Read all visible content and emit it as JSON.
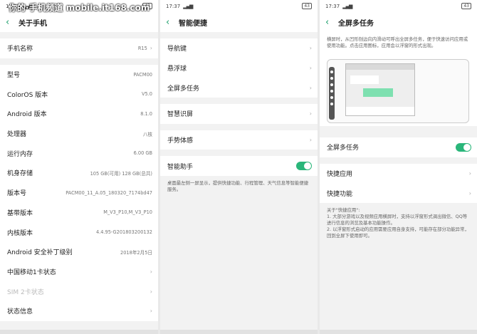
{
  "watermark": "你的·手机频道 mobile.it168.com",
  "status": {
    "time": "17:37",
    "signal": "▂▄▆",
    "battery": "43"
  },
  "screen1": {
    "title": "关于手机",
    "rows": [
      {
        "label": "手机名称",
        "value": "R15",
        "chev": "›"
      },
      {
        "label": "型号",
        "value": "PACM00"
      },
      {
        "label": "ColorOS 版本",
        "value": "V5.0"
      },
      {
        "label": "Android 版本",
        "value": "8.1.0"
      },
      {
        "label": "处理器",
        "value": "八核"
      },
      {
        "label": "运行内存",
        "value": "6.00 GB"
      },
      {
        "label": "机身存储",
        "value": "105 GB(可用)    128 GB(总共)"
      },
      {
        "label": "版本号",
        "value": "PACM00_11_A.05_180320_7174bd47"
      },
      {
        "label": "基带版本",
        "value": "M_V3_P10,M_V3_P10"
      },
      {
        "label": "内核版本",
        "value": "4.4.95-G201803200132"
      },
      {
        "label": "Android 安全补丁级别",
        "value": "2018年2月5日"
      },
      {
        "label": "中国移动1卡状态",
        "chev": "›"
      },
      {
        "label": "SIM 2卡状态",
        "chev": "›"
      },
      {
        "label": "状态信息",
        "chev": "›"
      }
    ]
  },
  "screen2": {
    "title": "智能便捷",
    "items": [
      "导航键",
      "悬浮球",
      "全屏多任务",
      "智慧识屏",
      "手势体感",
      "智能助手"
    ],
    "chev": "›",
    "desc": "桌面最左侧一屏显示，提供快捷功能、行程管理、天气信息等智能便捷服务。"
  },
  "screen3": {
    "title": "全屏多任务",
    "intro": "横屏时，从凹形刨边向内滑动可呼出全屏多任务，便于快速访问应用或使用功能。点击应用图标，应用会以浮窗的形式出现。",
    "toggle_label": "全屏多任务",
    "items": [
      "快捷应用",
      "快捷功能"
    ],
    "chev": "›",
    "notes": "关于\"快捷应用\":\n1. 大部分游戏以及视频应用横屏时，支持以浮窗形式调出微信、QQ等进行信息的浏览及基本功能操作。\n2. 以浮窗形式启动的应用需要应用自身支持，可能存在部分功能异常，回到全屏下使用即可。"
  }
}
